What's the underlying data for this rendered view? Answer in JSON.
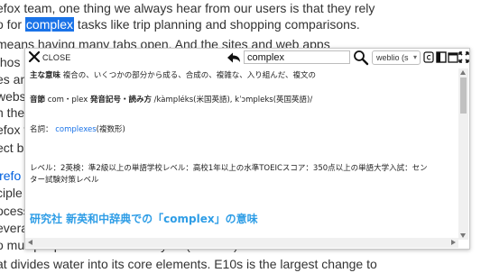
{
  "article": {
    "lines": [
      {
        "pre": "efox team, one thing we always hear from our users is that they rely",
        "hl": "",
        "post": "",
        "link": false
      },
      {
        "pre": "o for ",
        "hl": "complex",
        "post": " tasks like trip planning and shopping comparisons.",
        "link": false
      },
      {
        "pre": " means having many tabs open. And the sites and web apps",
        "hl": "",
        "post": "",
        "link": false
      },
      {
        "pre": " thos",
        "hl": "",
        "post": "",
        "link": false
      },
      {
        "pre": "es and",
        "hl": "",
        "post": "",
        "link": false
      },
      {
        "pre": "websit",
        "hl": "",
        "post": "",
        "link": false
      },
      {
        "pre": "n the g",
        "hl": "",
        "post": "",
        "link": false
      },
      {
        "pre": "efox te",
        "hl": "",
        "post": "",
        "link": false
      },
      {
        "pre": "ect br",
        "hl": "",
        "post": "",
        "link": false
      },
      {
        "pre": "",
        "hl": "",
        "post": "",
        "link": false
      },
      {
        "pre": "irefo",
        "hl": "",
        "post": "",
        "link": true
      },
      {
        "pre": "ciple o",
        "hl": "",
        "post": "",
        "link": false
      },
      {
        "pre": "ocess",
        "hl": "",
        "post": "",
        "link": false
      },
      {
        "pre": "everal",
        "hl": "",
        "post": "",
        "link": false
      },
      {
        "pre": "o multiple processes. Electrolysis (or E10s) is the chemical",
        "hl": "",
        "post": "",
        "link": false
      },
      {
        "pre": "at divides water into its core elements. E10s is the largest change to",
        "hl": "",
        "post": "",
        "link": false
      }
    ]
  },
  "popup": {
    "close_label": "CLOSE",
    "search_value": "complex",
    "dictionary": "weblio (s",
    "entry": {
      "main_label": "主な意味",
      "main_text": "複合の、いくつかの部分から成る、合成の、複雑な、入り組んだ、複文の",
      "pron_label": "音節",
      "pron_syll": "com・plex",
      "pron_label2": "発音記号・読み方",
      "pron_text": "/kàmpléks(米国英語), kˈɔmpleks(英国英語)/",
      "noun_label": "名詞：",
      "noun_link": "complexes",
      "noun_suffix": "(複数形)",
      "level_line1": "レベル：2英検：準2級以上の単語学校レベル：高校1年以上の水準TOEICスコア：350点以上の単語大学入試：セン",
      "level_line2": "ター試験対策レベル",
      "section_heading": "研究社 新英和中辞典での「complex」の意味"
    }
  },
  "colors": {
    "highlight": "#1a73e8",
    "link": "#1a73e8",
    "heading": "#2e9de6"
  },
  "icons": [
    "close-icon",
    "back-arrow-icon",
    "search-icon",
    "dropdown-arrow-icon",
    "settings-icon",
    "panel-icon",
    "window-icon",
    "expand-icon"
  ]
}
